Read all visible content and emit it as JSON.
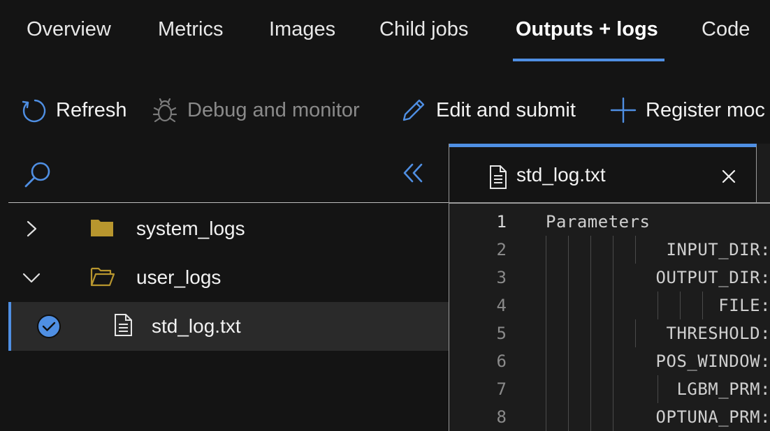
{
  "tabs": [
    {
      "label": "Overview",
      "active": false
    },
    {
      "label": "Metrics",
      "active": false
    },
    {
      "label": "Images",
      "active": false
    },
    {
      "label": "Child jobs",
      "active": false
    },
    {
      "label": "Outputs + logs",
      "active": true
    },
    {
      "label": "Code",
      "active": false
    }
  ],
  "toolbar": {
    "refresh": {
      "label": "Refresh",
      "icon": "refresh-icon",
      "enabled": true
    },
    "debug": {
      "label": "Debug and monitor",
      "icon": "bug-icon",
      "enabled": false
    },
    "edit": {
      "label": "Edit and submit",
      "icon": "pencil-icon",
      "enabled": true
    },
    "register": {
      "label": "Register moc",
      "icon": "plus-icon",
      "enabled": true
    }
  },
  "file_tree": {
    "items": [
      {
        "name": "system_logs",
        "type": "folder",
        "expanded": false
      },
      {
        "name": "user_logs",
        "type": "folder",
        "expanded": true
      },
      {
        "name": "std_log.txt",
        "type": "file",
        "selected": true
      }
    ]
  },
  "editor": {
    "tab_title": "std_log.txt",
    "lines": [
      {
        "n": "1",
        "text": "Parameters"
      },
      {
        "n": "2",
        "text": "INPUT_DIR:"
      },
      {
        "n": "3",
        "text": "OUTPUT_DIR:"
      },
      {
        "n": "4",
        "text": "FILE:"
      },
      {
        "n": "5",
        "text": "THRESHOLD:"
      },
      {
        "n": "6",
        "text": "POS_WINDOW:"
      },
      {
        "n": "7",
        "text": "LGBM_PRM:"
      },
      {
        "n": "8",
        "text": "OPTUNA_PRM:"
      }
    ]
  },
  "colors": {
    "accent": "#4f8fe3",
    "folder": "#b8962e",
    "background": "#141414",
    "selected_row": "#2a2a2a"
  }
}
